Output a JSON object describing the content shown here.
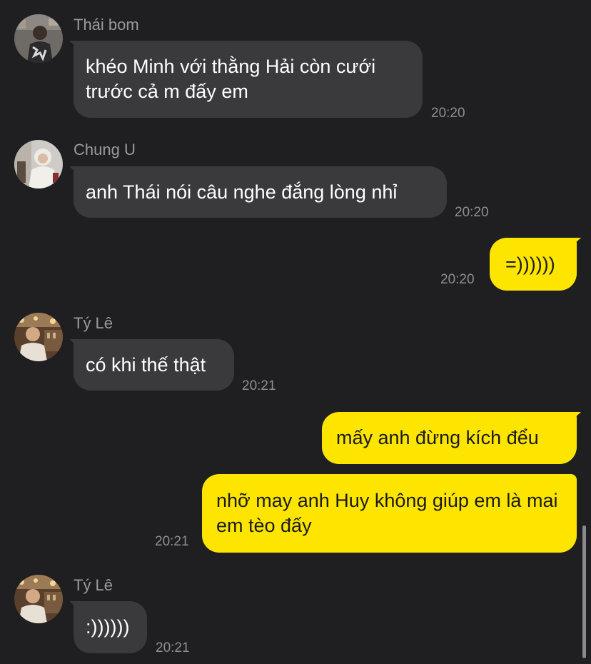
{
  "messages": [
    {
      "sender": "Thái bom",
      "text": "khéo Minh với thằng Hải còn cưới trước cả m đấy em",
      "time": "20:20",
      "direction": "incoming"
    },
    {
      "sender": "Chung U",
      "text": "anh Thái nói câu nghe đắng lòng nhỉ",
      "time": "20:20",
      "direction": "incoming"
    },
    {
      "text": "=))))))",
      "time": "20:20",
      "direction": "outgoing"
    },
    {
      "sender": "Tý Lê",
      "text": "có khi thế thật",
      "time": "20:21",
      "direction": "incoming"
    },
    {
      "text": "mấy anh đừng kích đểu",
      "direction": "outgoing"
    },
    {
      "text": "nhỡ may anh Huy không giúp em là mai em tèo đấy",
      "time": "20:21",
      "direction": "outgoing"
    },
    {
      "sender": "Tý Lê",
      "text": ":))))))",
      "time": "20:21",
      "direction": "incoming"
    }
  ],
  "colors": {
    "background": "#1f1f21",
    "incoming_bubble": "#3a3a3c",
    "outgoing_bubble": "#fee500",
    "sender_name": "#9a9aa0",
    "timestamp": "#8e8e93"
  }
}
